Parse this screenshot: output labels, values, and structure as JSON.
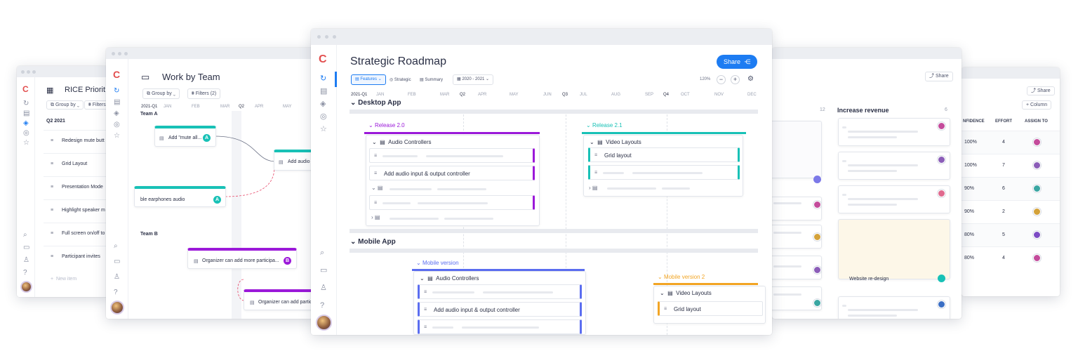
{
  "brand": {
    "accent": "#1d7cf2",
    "purple": "#9b19d9",
    "teal": "#18c1b6",
    "blue": "#5b6df0",
    "orange": "#f2a524"
  },
  "rice": {
    "title": "RICE Priorit",
    "group_by": "Group by",
    "filters": "Filters",
    "section": "Q2 2021",
    "rows": [
      "Redesign mute butt",
      "Grid Layout",
      "Presentation Mode",
      "Highlight speaker m",
      "Full screen on/off to",
      "Participant invites"
    ],
    "new_item": "New item"
  },
  "work": {
    "title": "Work by Team",
    "group_by": "Group by",
    "filters": "Filters (2)",
    "months": [
      "2021-Q1",
      "JAN",
      "FEB",
      "MAR",
      "Q2",
      "APR",
      "MAY"
    ],
    "team_a": "Team A",
    "team_b": "Team B",
    "cards": [
      "Add \"mute all...",
      "Add audio",
      "ble earphones audio",
      "Organizer can add more participa...",
      "Organizer can add partic"
    ],
    "avatar_letters": [
      "A",
      "A",
      "B"
    ]
  },
  "roadmap": {
    "title": "Strategic Roadmap",
    "share": "Share",
    "view_features": "Features",
    "view_strategic": "Strategic",
    "view_summary": "Summary",
    "date_range": "2020 - 2021",
    "zoom": "120%",
    "months": [
      "2021-Q1",
      "JAN",
      "FEB",
      "MAR",
      "Q2",
      "APR",
      "MAY",
      "JUN",
      "Q3",
      "JUL",
      "AUG",
      "SEP",
      "Q4",
      "OCT",
      "NOV",
      "DEC"
    ],
    "desktop": {
      "name": "Desktop App",
      "release1": "Release 2.0",
      "release2": "Release 2.1",
      "group1": "Audio Controllers",
      "feature1": "Add audio input & output controller",
      "group2": "Video Layouts",
      "feature2": "Grid layout"
    },
    "mobile": {
      "name": "Mobile App",
      "release1": "Mobile version",
      "release2": "Mobile version 2",
      "group1": "Audio Controllers",
      "feature1": "Add audio input & output controller",
      "group2": "Video Layouts",
      "feature2": "Grid layout"
    }
  },
  "board": {
    "share": "Share",
    "count": "12",
    "column_title": "Increase revenue",
    "column_count": "6",
    "card_title": "Website re-design"
  },
  "table": {
    "share": "Share",
    "add_column": "+ Column",
    "headers": [
      "NFIDENCE",
      "EFFORT",
      "ASSIGN TO"
    ],
    "rows": [
      {
        "confidence": "100%",
        "effort": "4"
      },
      {
        "confidence": "100%",
        "effort": "7"
      },
      {
        "confidence": "90%",
        "effort": "6"
      },
      {
        "confidence": "90%",
        "effort": "2"
      },
      {
        "confidence": "80%",
        "effort": "5"
      },
      {
        "confidence": "80%",
        "effort": "4"
      }
    ]
  }
}
